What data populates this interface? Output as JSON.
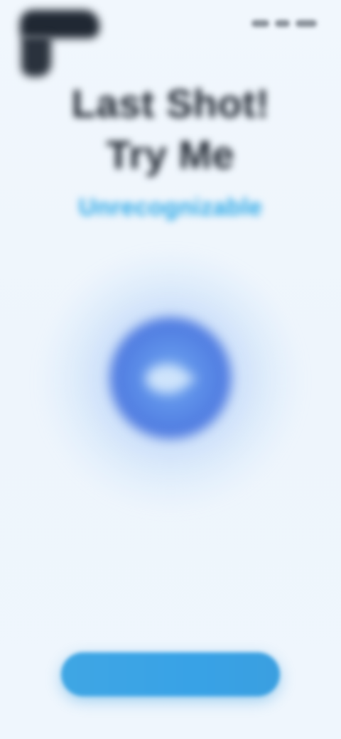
{
  "app": {
    "logo": "app-logo",
    "title_lines": [
      "Last Shot!",
      "Try Me"
    ],
    "subtitle": "Unrecognizable"
  },
  "status_bar": {
    "icons": [
      "signal-icon",
      "wifi-icon",
      "battery-icon"
    ]
  },
  "orb": {
    "icon": "play-icon"
  },
  "hints": {
    "small": "",
    "large": ""
  },
  "cta": {
    "label": ""
  },
  "colors": {
    "background": "#eef5fc",
    "title": "#1f2630",
    "accent": "#26a6e6",
    "orb": "#5d8fe9",
    "cta": "#3fa6e4"
  }
}
